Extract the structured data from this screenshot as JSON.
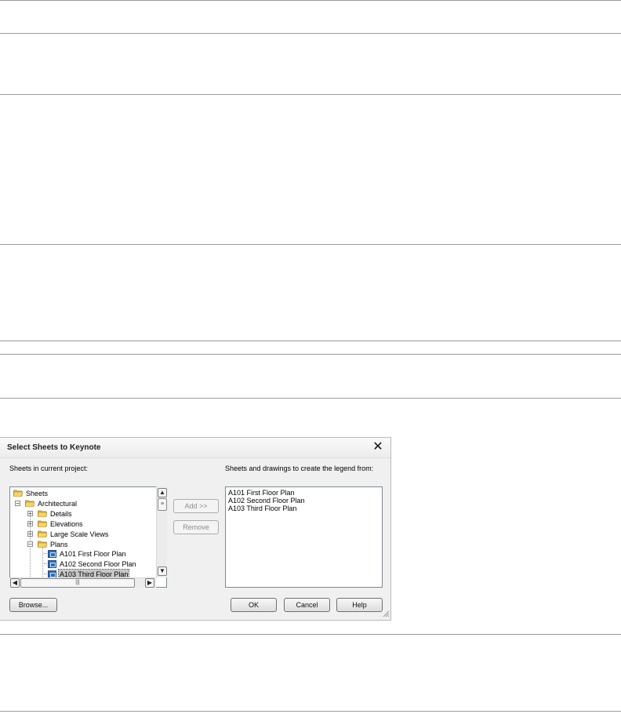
{
  "dialog": {
    "title": "Select Sheets to Keynote",
    "left_label": "Sheets in current project:",
    "right_label": "Sheets and drawings to create the legend from:"
  },
  "tree": {
    "root": "Sheets",
    "architectural": "Architectural",
    "details": "Details",
    "elevations": "Elevations",
    "large_scale_views": "Large Scale Views",
    "plans": "Plans",
    "sheet1": "A101 First Floor Plan",
    "sheet2": "A102 Second Floor Plan",
    "sheet3": "A103 Third Floor Plan"
  },
  "selected_list": [
    "A101 First Floor Plan",
    "A102 Second Floor Plan",
    "A103 Third Floor Plan"
  ],
  "buttons": {
    "add": "Add >>",
    "remove": "Remove",
    "browse": "Browse...",
    "ok": "OK",
    "cancel": "Cancel",
    "help": "Help"
  },
  "icons": {
    "folder": "folder-icon",
    "sheet": "sheet-icon",
    "close": "close-icon"
  },
  "colors": {
    "folder": "#e8b93a",
    "sheet": "#2f6db8",
    "selection": "#c8c8c8"
  }
}
